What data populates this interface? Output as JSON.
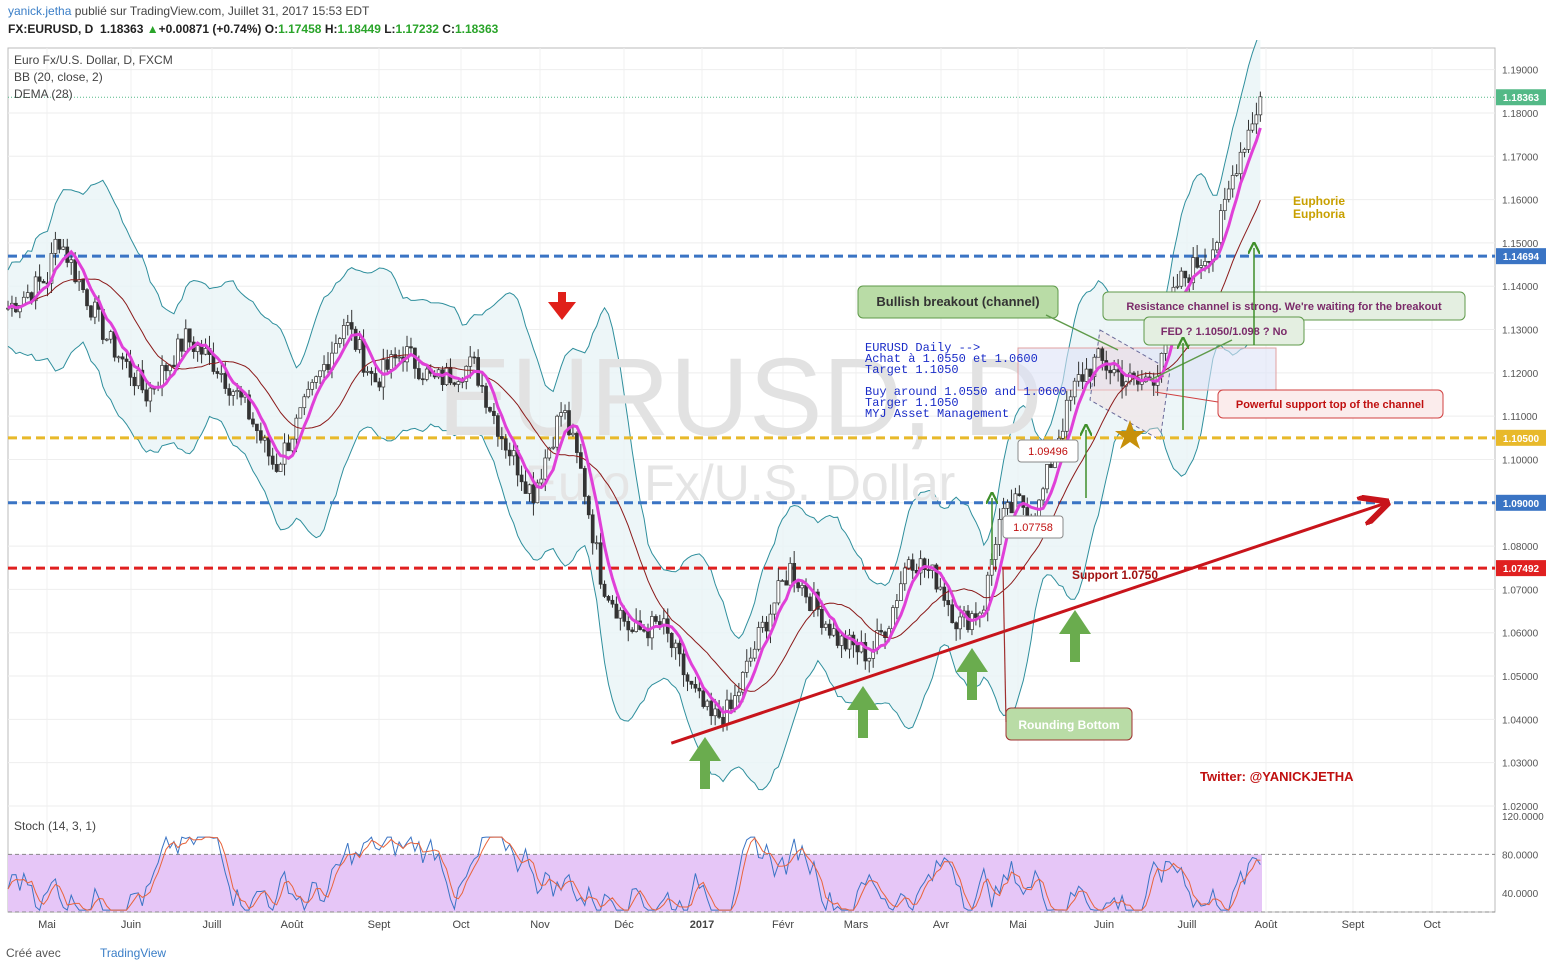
{
  "header": {
    "author": "yanick.jetha",
    "published": "publié sur TradingView.com, Juillet 31, 2017 15:53 EDT",
    "ticker": "FX:EURUSD, D",
    "price": "1.18363",
    "change": "+0.00871 (+0.74%)",
    "ohlc": {
      "o_label": "O:",
      "o": "1.17458",
      "h_label": "H:",
      "h": "1.18449",
      "l_label": "L:",
      "l": "1.17232",
      "c_label": "C:",
      "c": "1.18363"
    }
  },
  "indicators": {
    "title": "Euro Fx/U.S. Dollar, D, FXCM",
    "bb": "BB (20, close, 2)",
    "dema": "DEMA (28)",
    "stoch": "Stoch (14, 3, 1)"
  },
  "watermark": {
    "line1": "EURUSD, D",
    "line2": "Euro Fx/U.S. Dollar"
  },
  "annotations": {
    "bullish_breakout": "Bullish breakout (channel)",
    "resistance_note": "Resistance channel is strong. We're waiting for the breakout",
    "fed_note": "FED ? 1.1050/1.098 ? No",
    "support_channel": "Powerful support top of the channel",
    "rounding_bottom": "Rounding Bottom",
    "support_1075": "Support 1.0750",
    "euphorie": "Euphorie",
    "euphoria": "Euphoria",
    "twitter": "Twitter: @YANICKJETHA",
    "label_109496": "1.09496",
    "label_107758": "1.07758",
    "blue_text": [
      "EURUSD Daily -->",
      "Achat à 1.0550 et 1.0600",
      "Target 1.1050",
      "",
      "Buy around 1.0550 and 1.0600",
      "Targer 1.1050",
      "MYJ Asset Management"
    ]
  },
  "colors": {
    "up": "#53b987",
    "down": "#eb4d5c",
    "candle": "#333333",
    "dema": "#e040d8",
    "bb_band": "#2f8f9d",
    "bb_fill": "#e9f4f6",
    "sma": "#8b1a1a",
    "blue_dash": "#3a74c4",
    "yellow_dash": "#e8b92a",
    "red_dash": "#e02020",
    "trendline": "#c8141b",
    "arrow_green": "#6aac4e",
    "stoch_fill": "#e6c6f7"
  },
  "chart_data": {
    "type": "candlestick",
    "symbol": "EURUSD",
    "timeframe": "D",
    "ylim": [
      1.02,
      1.195
    ],
    "y_ticks": [
      "1.19000",
      "1.18000",
      "1.17000",
      "1.16000",
      "1.15000",
      "1.14000",
      "1.13000",
      "1.12000",
      "1.11000",
      "1.10000",
      "1.09000",
      "1.08000",
      "1.07000",
      "1.06000",
      "1.05000",
      "1.04000",
      "1.03000",
      "1.02000"
    ],
    "x_ticks": [
      "Mai",
      "Juin",
      "Juill",
      "Août",
      "Sept",
      "Oct",
      "Nov",
      "Déc",
      "2017",
      "Févr",
      "Mars",
      "Avr",
      "Mai",
      "Juin",
      "Juill",
      "Août",
      "Sept",
      "Oct"
    ],
    "price_series": [
      {
        "t": 0.0,
        "c": 1.135
      },
      {
        "t": 0.04,
        "c": 1.142
      },
      {
        "t": 0.05,
        "c": 1.152
      },
      {
        "t": 0.07,
        "c": 1.142
      },
      {
        "t": 0.1,
        "c": 1.128
      },
      {
        "t": 0.14,
        "c": 1.115
      },
      {
        "t": 0.18,
        "c": 1.128
      },
      {
        "t": 0.21,
        "c": 1.122
      },
      {
        "t": 0.24,
        "c": 1.112
      },
      {
        "t": 0.27,
        "c": 1.098
      },
      {
        "t": 0.3,
        "c": 1.112
      },
      {
        "t": 0.34,
        "c": 1.132
      },
      {
        "t": 0.37,
        "c": 1.118
      },
      {
        "t": 0.4,
        "c": 1.125
      },
      {
        "t": 0.43,
        "c": 1.118
      },
      {
        "t": 0.47,
        "c": 1.122
      },
      {
        "t": 0.5,
        "c": 1.105
      },
      {
        "t": 0.53,
        "c": 1.092
      },
      {
        "t": 0.56,
        "c": 1.112
      },
      {
        "t": 0.58,
        "c": 1.096
      },
      {
        "t": 0.6,
        "c": 1.072
      },
      {
        "t": 0.63,
        "c": 1.06
      },
      {
        "t": 0.66,
        "c": 1.062
      },
      {
        "t": 0.69,
        "c": 1.047
      },
      {
        "t": 0.71,
        "c": 1.04
      },
      {
        "t": 0.73,
        "c": 1.042
      },
      {
        "t": 0.76,
        "c": 1.06
      },
      {
        "t": 0.79,
        "c": 1.075
      },
      {
        "t": 0.81,
        "c": 1.068
      },
      {
        "t": 0.84,
        "c": 1.058
      },
      {
        "t": 0.87,
        "c": 1.055
      },
      {
        "t": 0.89,
        "c": 1.063
      },
      {
        "t": 0.91,
        "c": 1.078
      },
      {
        "t": 0.94,
        "c": 1.072
      },
      {
        "t": 0.96,
        "c": 1.062
      },
      {
        "t": 0.985,
        "c": 1.066
      },
      {
        "t": 1.0,
        "c": 1.085
      },
      {
        "t": 1.02,
        "c": 1.09
      },
      {
        "t": 1.04,
        "c": 1.088
      },
      {
        "t": 1.06,
        "c": 1.105
      },
      {
        "t": 1.08,
        "c": 1.118
      },
      {
        "t": 1.1,
        "c": 1.123
      },
      {
        "t": 1.12,
        "c": 1.12
      },
      {
        "t": 1.14,
        "c": 1.117
      },
      {
        "t": 1.16,
        "c": 1.12
      },
      {
        "t": 1.18,
        "c": 1.14
      },
      {
        "t": 1.2,
        "c": 1.145
      },
      {
        "t": 1.22,
        "c": 1.15
      },
      {
        "t": 1.24,
        "c": 1.168
      },
      {
        "t": 1.265,
        "c": 1.1836
      }
    ],
    "horizontal_levels": [
      {
        "value": 1.14694,
        "label": "1.14694",
        "style": "blue-dashed"
      },
      {
        "value": 1.105,
        "label": "1.10500",
        "style": "yellow-dashed"
      },
      {
        "value": 1.09,
        "label": "1.09000",
        "style": "blue-dashed"
      },
      {
        "value": 1.07492,
        "label": "1.07492",
        "style": "red-dashed"
      }
    ],
    "last_price": {
      "value": 1.18363,
      "label": "1.18363"
    },
    "trendline": {
      "from": {
        "t": 0.67,
        "v": 1.0345
      },
      "to": {
        "t": 1.39,
        "v": 1.0898
      }
    },
    "stoch": {
      "ylim": [
        20,
        120
      ],
      "y_ticks": [
        "120.0000",
        "80.0000",
        "40.0000"
      ],
      "levels": [
        80,
        20
      ]
    }
  }
}
